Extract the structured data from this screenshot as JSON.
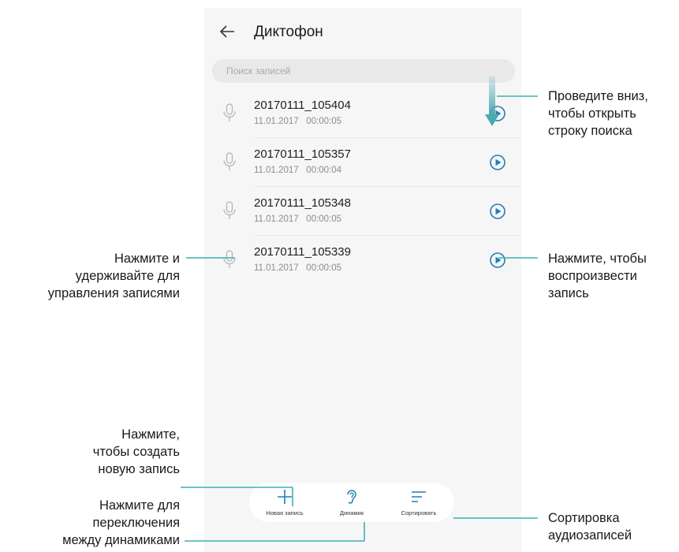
{
  "app": {
    "title": "Диктофон"
  },
  "search": {
    "placeholder": "Поиск записей"
  },
  "recordings": [
    {
      "name": "20170111_105404",
      "date": "11.01.2017",
      "duration": "00:00:05"
    },
    {
      "name": "20170111_105357",
      "date": "11.01.2017",
      "duration": "00:00:04"
    },
    {
      "name": "20170111_105348",
      "date": "11.01.2017",
      "duration": "00:00:05"
    },
    {
      "name": "20170111_105339",
      "date": "11.01.2017",
      "duration": "00:00:05"
    }
  ],
  "bottom_bar": {
    "new_record": "Новая запись",
    "speaker": "Динамик",
    "sort": "Сортировать"
  },
  "annotations": {
    "swipe_down": [
      "Проведите вниз,",
      "чтобы открыть",
      "строку поиска"
    ],
    "play": [
      "Нажмите, чтобы",
      "воспроизвести",
      "запись"
    ],
    "long_press": [
      "Нажмите и",
      "удерживайте для",
      "управления записями"
    ],
    "new_record": [
      "Нажмите,",
      "чтобы создать",
      "новую запись"
    ],
    "switch_speaker": [
      "Нажмите для",
      "переключения",
      "между динамиками"
    ],
    "sort": [
      "Сортировка",
      "аудиозаписей"
    ]
  },
  "colors": {
    "accent": "#1e7fb6",
    "callout_line": "#3ab1b5",
    "icon_gray": "#b5b5b5",
    "swipe_arrow": "#4aa8b3"
  }
}
